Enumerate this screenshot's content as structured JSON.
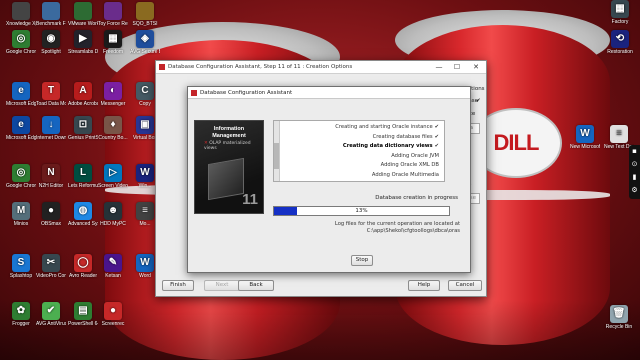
{
  "desktop_left": [
    {
      "label": "Xnowledge Xpert",
      "color": "#444"
    },
    {
      "label": "Benchmark Factory 8...",
      "color": "#3b6a9e"
    },
    {
      "label": "VMware Workstati...",
      "color": "#2d6b33"
    },
    {
      "label": "Toy Force Reloaded",
      "color": "#6a2c8b"
    },
    {
      "label": "SQO_BTSI",
      "color": "#8a6a20"
    },
    {
      "label": "Google Chrome",
      "color": "#2e7d32",
      "glyph": "◎"
    },
    {
      "label": "Spotlight",
      "color": "#222",
      "glyph": "◉"
    },
    {
      "label": "Streamlabs Desktop",
      "color": "#23222b",
      "glyph": "▶"
    },
    {
      "label": "Freedom",
      "color": "#1b1b1b",
      "glyph": "▦"
    },
    {
      "label": "AVG Secure Browser",
      "color": "#1f4e9c",
      "glyph": "◈"
    },
    {
      "label": "Microsoft Edge",
      "color": "#1565c0",
      "glyph": "e"
    },
    {
      "label": "Toad Data Modeler 8",
      "color": "#c62828",
      "glyph": "T"
    },
    {
      "label": "Adobe Acrobat",
      "color": "#b71c1c",
      "glyph": "A"
    },
    {
      "label": "Messenger",
      "color": "#7b1fa2",
      "glyph": "◐"
    },
    {
      "label": "Copy",
      "color": "#455a64",
      "glyph": "C"
    },
    {
      "label": "Microsoft Edge",
      "color": "#0d47a1",
      "glyph": "e"
    },
    {
      "label": "Internet Download...",
      "color": "#1565c0",
      "glyph": "↓"
    },
    {
      "label": "Genius PrintScreen",
      "color": "#37474f",
      "glyph": "⊡"
    },
    {
      "label": "Country Bo...",
      "color": "#795548",
      "glyph": "♦"
    },
    {
      "label": "Virtual Box",
      "color": "#283593",
      "glyph": "▣"
    },
    {
      "label": "Google Chrome",
      "color": "#2e7d32",
      "glyph": "◎"
    },
    {
      "label": "N2H Editor",
      "color": "#6a1b1b",
      "glyph": "N"
    },
    {
      "label": "Lets Reformule",
      "color": "#004d40",
      "glyph": "L"
    },
    {
      "label": "Screen Video Capture Sof...",
      "color": "#0277bd",
      "glyph": "▷"
    },
    {
      "label": "Win...",
      "color": "#1a237e",
      "glyph": "W"
    },
    {
      "label": "Minios",
      "color": "#546e7a",
      "glyph": "M"
    },
    {
      "label": "OBSmax",
      "color": "#212121",
      "glyph": "●"
    },
    {
      "label": "Advanced SystemCare",
      "color": "#1e88e5",
      "glyph": "◍"
    },
    {
      "label": "HDD MyPC",
      "color": "#263238",
      "glyph": "☻"
    },
    {
      "label": "Mo...",
      "color": "#424242",
      "glyph": "≡"
    },
    {
      "label": "Splashtop",
      "color": "#1976d2",
      "glyph": "S"
    },
    {
      "label": "VideoPro Converter",
      "color": "#37474f",
      "glyph": "✂"
    },
    {
      "label": "Avro Reader",
      "color": "#c62828",
      "glyph": "◯"
    },
    {
      "label": "Ketsan",
      "color": "#4a148c",
      "glyph": "✎"
    },
    {
      "label": "Word",
      "color": "#1565c0",
      "glyph": "W"
    },
    {
      "label": "Frogger",
      "color": "#2e7d32",
      "glyph": "✿"
    },
    {
      "label": "AVG AntiVirus",
      "color": "#4caf50",
      "glyph": "✔"
    },
    {
      "label": "PowerShell 64-bit IS...",
      "color": "#2e7d32",
      "glyph": "▤"
    },
    {
      "label": "Screenrec",
      "color": "#c62828",
      "glyph": "●"
    }
  ],
  "desktop_right": [
    {
      "label": "Factory",
      "color": "#37474f",
      "glyph": "▦"
    },
    {
      "label": "Restoration",
      "color": "#1a237e",
      "glyph": "⟲"
    },
    {
      "label": "New Microsoft...",
      "color": "#1565c0",
      "glyph": "W"
    },
    {
      "label": "New Text Document",
      "color": "#e0e0e0",
      "glyph": "≡"
    },
    {
      "label": "Recycle Bin",
      "color": "#90a4ae",
      "glyph": "🗑"
    }
  ],
  "wallpaper": {
    "logo_text": "DILL"
  },
  "outer_window": {
    "title": "Database Configuration Assistant, Step 11 of 11 : Creation Options",
    "minimize": "—",
    "maximize": "☐",
    "close": "✕",
    "side_1": "tion options",
    "side_2": "atabase",
    "side_3": "mplate",
    "side_4": "crea",
    "side_5": "cripts",
    "side_6": "Browse",
    "finish": "Finish",
    "next": "Next",
    "back": "Back",
    "help": "Help",
    "cancel": "Cancel"
  },
  "dialog": {
    "title": "Database Configuration Assistant",
    "banner_title": "Information Management",
    "banner_item": "OLAP materialized views",
    "banner_version": "11",
    "steps": [
      {
        "label": "Creating and starting Oracle instance",
        "done": true,
        "current": false
      },
      {
        "label": "Creating database files",
        "done": true,
        "current": false
      },
      {
        "label": "Creating data dictionary views",
        "done": true,
        "current": true
      },
      {
        "label": "Adding Oracle JVM",
        "done": false,
        "current": false
      },
      {
        "label": "Adding Oracle XML DB",
        "done": false,
        "current": false
      },
      {
        "label": "Adding Oracle Multimedia",
        "done": false,
        "current": false
      }
    ],
    "check_mark": "✔",
    "status": "Database creation in progress",
    "progress_percent": 13,
    "progress_text": "13%",
    "log_line1": "Log files for the current operation are located at",
    "log_line2": "C:\\app\\Shekol\\cfgtoollogs\\dbca\\oras",
    "stop": "Stop"
  },
  "right_toolbar": [
    "▪",
    "⊙",
    "▮",
    "⚙"
  ]
}
